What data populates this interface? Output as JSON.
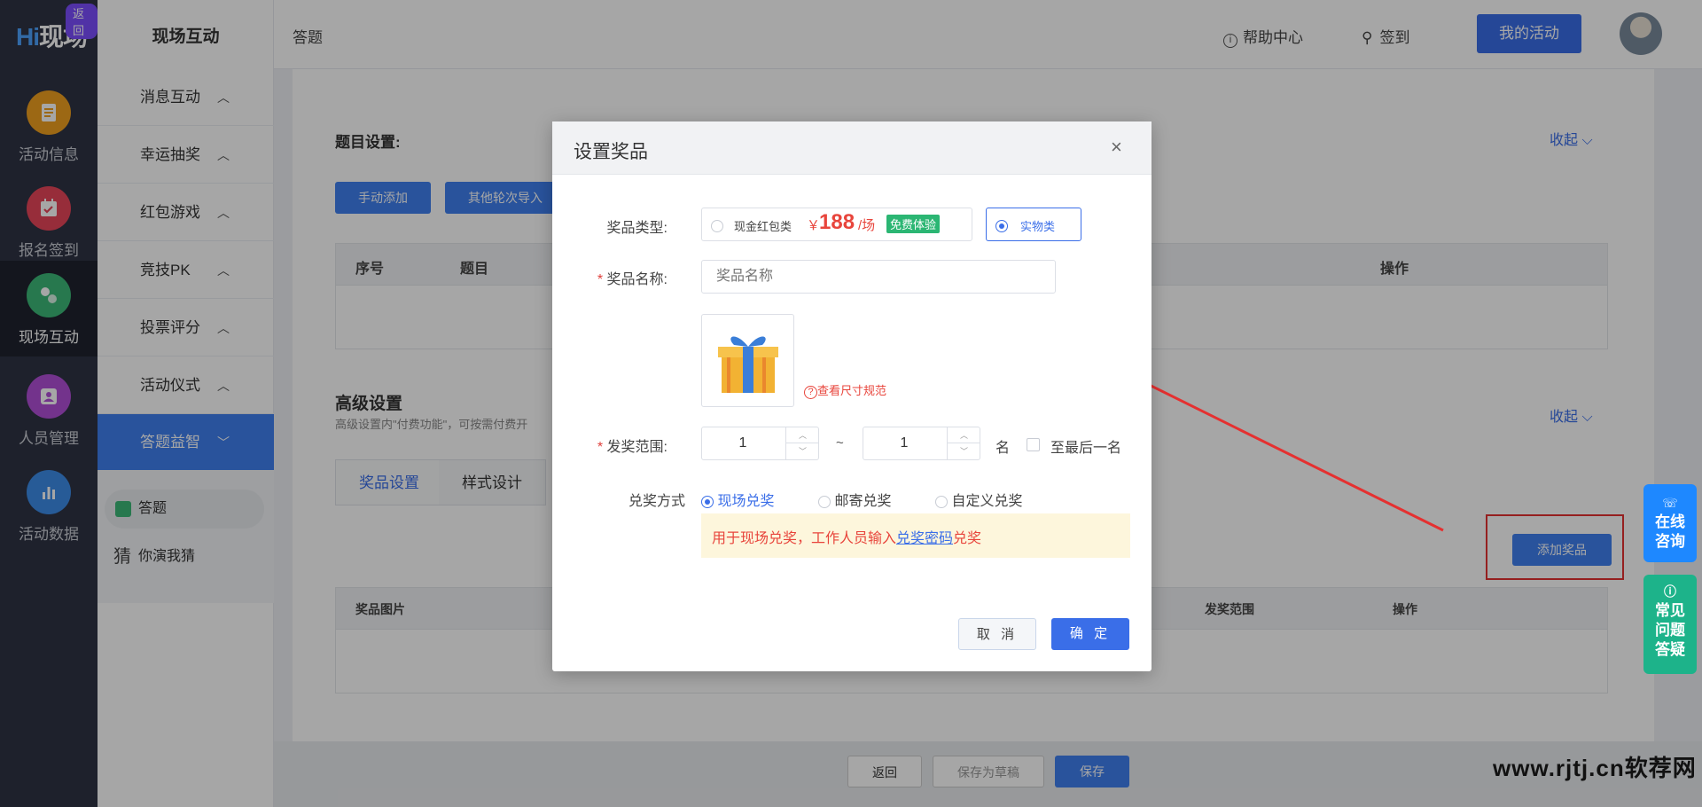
{
  "logo": {
    "text_hi": "Hi",
    "text_rest": "现场",
    "back_badge": "返回"
  },
  "rail": {
    "items": [
      {
        "label": "活动信息",
        "icon": "document-icon",
        "color": "#f0a020"
      },
      {
        "label": "报名签到",
        "icon": "calendar-check-icon",
        "color": "#e8455a"
      },
      {
        "label": "现场互动",
        "icon": "interaction-icon",
        "color": "#3cb878"
      },
      {
        "label": "人员管理",
        "icon": "user-card-icon",
        "color": "#b14fd8"
      },
      {
        "label": "活动数据",
        "icon": "bar-chart-icon",
        "color": "#3c8ce8"
      }
    ]
  },
  "subnav": {
    "title": "现场互动",
    "items": [
      {
        "label": "消息互动"
      },
      {
        "label": "幸运抽奖"
      },
      {
        "label": "红包游戏"
      },
      {
        "label": "竞技PK"
      },
      {
        "label": "投票评分"
      },
      {
        "label": "活动仪式"
      },
      {
        "label": "答题益智"
      }
    ],
    "subitems": [
      {
        "label": "答题",
        "icon_text": ""
      },
      {
        "label": "你演我猜",
        "icon_text": "猜"
      }
    ]
  },
  "header": {
    "breadcrumb": "答题",
    "help": "帮助中心",
    "signin": "签到",
    "my_activity": "我的活动"
  },
  "content": {
    "topic_settings": "题目设置:",
    "fold": "收起",
    "fold_arrow": "⌵",
    "manual_add": "手动添加",
    "import_other": "其他轮次导入",
    "table1": {
      "col_no": "序号",
      "col_question": "题目",
      "col_ops": "操作"
    },
    "advanced_title": "高级设置",
    "advanced_note": "高级设置内\"付费功能\"，可按需付费开",
    "tabs": [
      "奖品设置",
      "样式设计"
    ],
    "add_prize": "添加奖品",
    "table2": {
      "col_image": "奖品图片",
      "col_range": "发奖范围",
      "col_ops": "操作"
    }
  },
  "bottom": {
    "back": "返回",
    "draft": "保存为草稿",
    "save": "保存"
  },
  "float": {
    "online": [
      "在线",
      "咨询"
    ],
    "faq": [
      "常见",
      "问题",
      "答疑"
    ]
  },
  "modal": {
    "title": "设置奖品",
    "close": "×",
    "prize_type_label": "奖品类型:",
    "cash_option": "现金红包类",
    "price_symbol": "￥",
    "price_value": "188",
    "price_unit": "/场",
    "free_trial": "免费体验",
    "physical_option": "实物类",
    "name_label": "奖品名称:",
    "name_placeholder": "奖品名称",
    "size_link": "查看尺寸规范",
    "range_label": "发奖范围:",
    "range_from": "1",
    "range_to": "1",
    "range_sep": "~",
    "range_unit": "名",
    "to_last": "至最后一名",
    "redeem_label": "兑奖方式",
    "redeem_options": [
      "现场兑奖",
      "邮寄兑奖",
      "自定义兑奖"
    ],
    "redeem_tip_pre": "用于现场兑奖，工作人员输入",
    "redeem_tip_link": "兑奖密码",
    "redeem_tip_post": "兑奖",
    "cancel": "取 消",
    "confirm": "确 定"
  },
  "watermark": "www.rjtj.cn软荐网"
}
